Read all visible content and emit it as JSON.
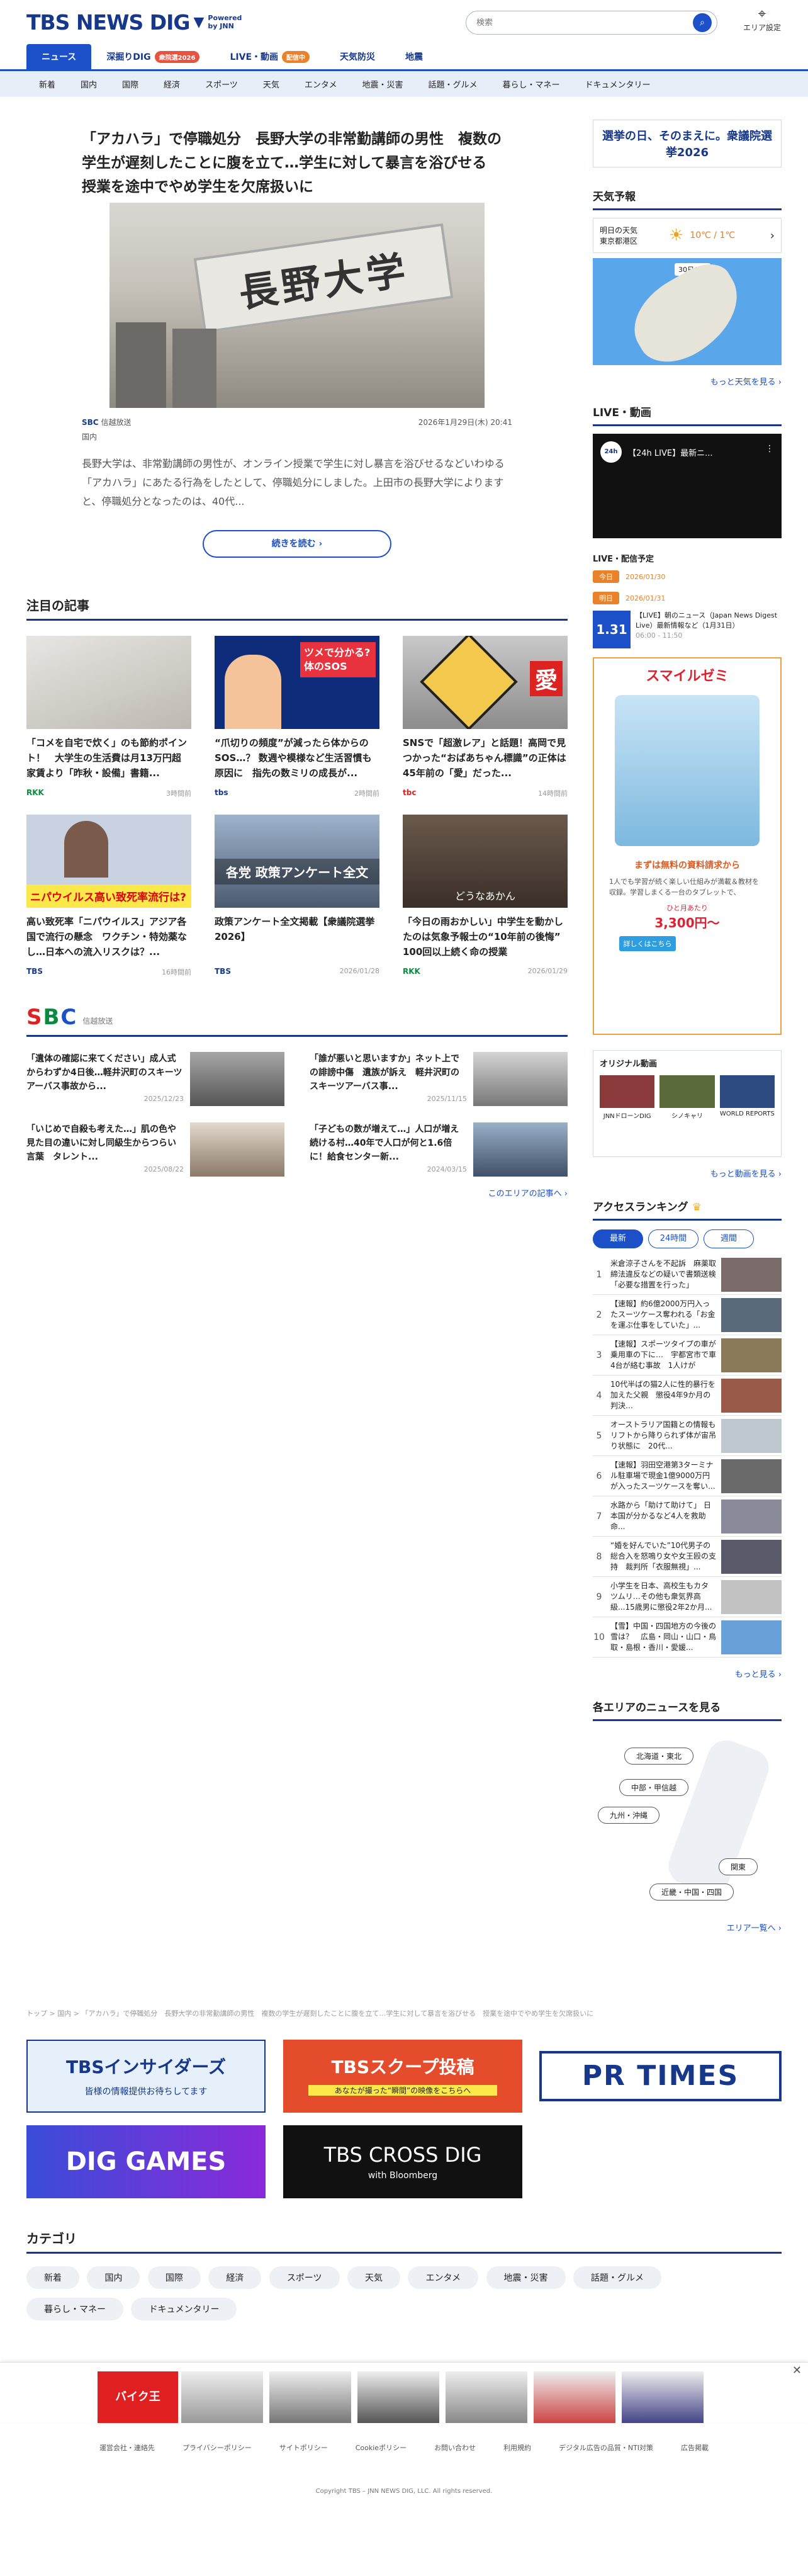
{
  "header": {
    "logo": "TBS NEWS DIG",
    "powered": "Powered by JNN",
    "search_placeholder": "検索",
    "area_label": "エリア設定"
  },
  "tabs": [
    {
      "label": "ニュース",
      "badge": ""
    },
    {
      "label": "深掘りDIG",
      "badge": "衆院選2026"
    },
    {
      "label": "LIVE・動画",
      "badge": "配信中"
    },
    {
      "label": "天気防災",
      "badge": ""
    },
    {
      "label": "地震",
      "badge": ""
    }
  ],
  "categories": [
    "新着",
    "国内",
    "国際",
    "経済",
    "スポーツ",
    "天気",
    "エンタメ",
    "地震・災害",
    "話題・グルメ",
    "暮らし・マネー",
    "ドキュメンタリー"
  ],
  "lead": {
    "title": "「アカハラ」で停職処分　長野大学の非常勤講師の男性　複数の学生が遅刻したことに腹を立て…学生に対して暴言を浴びせる　授業を途中でやめ学生を欠席扱いに",
    "image_text": "長野大学",
    "source": "信越放送",
    "source_logo": "SBC",
    "category": "国内",
    "date": "2026年1月29日(木) 20:41",
    "body": "長野大学は、非常勤講師の男性が、オンライン授業で学生に対し暴言を浴びせるなどいわゆる「アカハラ」にあたる行為をしたとして、停職処分にしました。上田市の長野大学によりますと、停職処分となったのは、40代...",
    "more_label": "続きを読む"
  },
  "featured": {
    "heading": "注目の記事",
    "items": [
      {
        "title": "「コメを自宅で炊く」のも節約ポイント！　大学生の生活費は月13万円超　家賃より「昨秋・設備」書籍...",
        "source": "RKK",
        "ago": "3時間前",
        "overlay": ""
      },
      {
        "title": "“爪切りの頻度”が減ったら体からのSOS…？ 数週や模様など生活習慣も原因に　指先の数ミリの成長が...",
        "source": "tbs",
        "ago": "2時間前",
        "overlay": "ツメで分かる?体のSOS"
      },
      {
        "title": "SNSで「超激レア」と話題！高岡で見つかった“おばあちゃん標識”の正体は45年前の「愛」だった...",
        "source": "tbc",
        "ago": "14時間前",
        "overlay": "愛"
      },
      {
        "title": "高い致死率「ニパウイルス」アジア各国で流行の懸念　ワクチン・特効薬なし…日本への流入リスクは？...",
        "source": "TBS",
        "ago": "16時間前",
        "overlay": "ニパウイルス高い致死率流行は?"
      },
      {
        "title": "政策アンケート全文掲載【衆議院選挙2026】",
        "source": "TBS",
        "ago": "2026/01/28",
        "overlay": "各党 政策アンケート全文"
      },
      {
        "title": "「今日の雨おかしい」中学生を動かしたのは気象予報士の“10年前の後悔”　100回以上続く命の授業",
        "source": "RKK",
        "ago": "2026/01/29",
        "overlay": "どうなあかん"
      }
    ]
  },
  "sbc": {
    "logo": "SBC",
    "station": "信越放送",
    "items": [
      {
        "title": "「遺体の確認に来てください」成人式からわずか4日後…軽井沢町のスキーツアーバス事故から...",
        "date": "2025/12/23"
      },
      {
        "title": "「誰が悪いと思いますか」ネット上での誹謗中傷　遺族が訴え　軽井沢町のスキーツアーバス事...",
        "date": "2025/11/15"
      },
      {
        "title": "「いじめで自殺も考えた…」肌の色や見た目の違いに対し同級生からつらい言葉　タレント...",
        "date": "2025/08/22"
      },
      {
        "title": "「子どもの数が増えて…」人口が増え続ける村…40年で人口が何と1.6倍に！給食センター新...",
        "date": "2024/03/15"
      }
    ],
    "more_label": "このエリアの記事へ"
  },
  "sidebar": {
    "banner_text": "選挙の日、そのまえに。衆議院選挙2026",
    "weather": {
      "heading": "天気予報",
      "day": "明日の天気",
      "place": "東京都港区",
      "temp": "10℃ / 1℃",
      "map_date": "30日(金)",
      "more": "もっと天気を見る"
    },
    "live": {
      "heading": "LIVE・動画",
      "video_title": "【24h LIVE】最新ニ...",
      "schedule_heading": "LIVE・配信予定",
      "schedule": [
        {
          "badge": "今日",
          "date": "2026/01/30"
        },
        {
          "badge": "明日",
          "date": "2026/01/31"
        }
      ],
      "next_title": "【LIVE】朝のニュース（Japan News Digest Live）最新情報など（1月31日）",
      "next_time": "06:00 - 11:50",
      "next_thumb": "1.31"
    },
    "ad": {
      "brand": "スマイルゼミ",
      "headline": "まずは無料の資料請求から",
      "text": "1人でも学習が続く楽しい仕組みが満載＆教材を収録。学習しまくる一台のタブレットで、",
      "price_label": "ひと月あたり",
      "price": "3,300円〜",
      "btn": "詳しくはこちら"
    },
    "original": {
      "heading": "オリジナル動画",
      "items": [
        "JNNドローンDIG",
        "シノキャリ",
        "WORLD REPORTS"
      ],
      "more": "もっと動画を見る"
    },
    "ranking": {
      "heading": "アクセスランキング",
      "tabs": [
        "最新",
        "24時間",
        "週間"
      ],
      "items": [
        "米倉涼子さんを不起訴　麻薬取締法違反などの疑いで書類送検「必要な措置を行った」",
        "【速報】約6億2000万円入ったスーツケース奪われる「お金を運ぶ仕事をしていた」...",
        "【速報】スポーツタイプの車が乗用車の下に…　宇都宮市で車4台が絡む事故　1人けが",
        "10代半ばの猫2人に性的暴行を加えた父親　懲役4年9か月の判決…",
        "オーストラリア国籍との情報もリフトから降りられず体が宙吊り状態に　20代...",
        "【速報】羽田空港第3ターミナル駐車場で現金1億9000万円が入ったスーツケースを奪い...",
        "水路から「助けて助けて」 日本国が分かるなど4人を救助　命...",
        "“婚を好んでいた”10代男子の総合入を怒鳴り女や女王殴の支持　裁判所「衣服無視」...",
        "小学生を日本、高校生もカタツムリ…その他も衆気界高級...15歳男に懲役2年2か月...",
        "【雪】中国・四国地方の今後の雪は？　広島・岡山・山口・鳥取・島根・香川・愛媛..."
      ],
      "more": "もっと見る"
    },
    "areas": {
      "heading": "各エリアのニュースを見る",
      "buttons": [
        "北海道・東北",
        "中部・甲信越",
        "九州・沖縄",
        "関東",
        "近畿・中国・四国"
      ],
      "more": "エリア一覧へ"
    }
  },
  "breadcrumb": "トップ > 国内 > 「アカハラ」で停職処分　長野大学の非常勤講師の男性　複数の学生が遅刻したことに腹を立て…学生に対して暴言を浴びせる　授業を途中でやめ学生を欠席扱いに",
  "promos": [
    {
      "name": "TBSインサイダーズ",
      "sub": "皆様の情報提供お待ちしてます"
    },
    {
      "name": "TBSスクープ投稿",
      "sub": "あなたが撮った“瞬間”の映像をこちらへ"
    },
    {
      "name": "PR TIMES",
      "sub": ""
    },
    {
      "name": "DIG GAMES",
      "sub": ""
    },
    {
      "name": "TBS CROSS DIG",
      "sub": "with Bloomberg"
    }
  ],
  "category_section": {
    "heading": "カテゴリ",
    "items": [
      "新着",
      "国内",
      "国際",
      "経済",
      "スポーツ",
      "天気",
      "エンタメ",
      "地震・災害",
      "話題・グルメ",
      "暮らし・マネー",
      "ドキュメンタリー"
    ]
  },
  "bottom_ad": {
    "logo": "バイク王"
  },
  "footer": {
    "links": [
      "運営会社・連絡先",
      "プライバシーポリシー",
      "サイトポリシー",
      "Cookieポリシー",
      "お問い合わせ",
      "利用規約",
      "デジタル広告の品質・NTI対策",
      "広告掲載"
    ],
    "copyright": "Copyright TBS – JNN NEWS DIG, LLC. All rights reserved."
  },
  "colors": {
    "brand": "#17388a",
    "accent": "#1c50c9",
    "badge": "#e8533f"
  }
}
